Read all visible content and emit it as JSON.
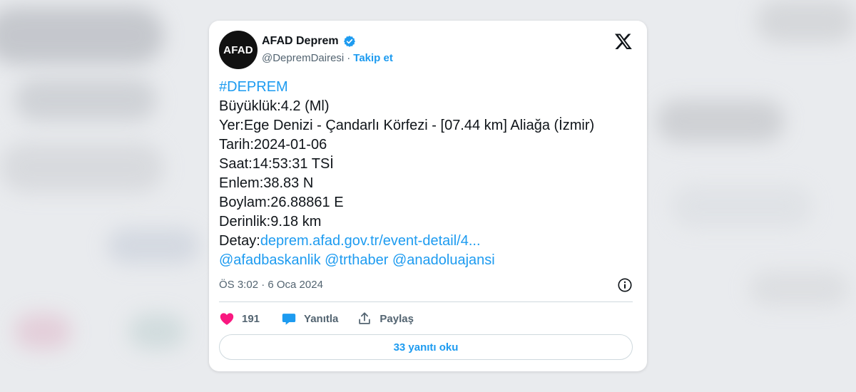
{
  "author": {
    "avatar_text": "AFAD",
    "display_name": "AFAD Deprem",
    "handle": "@DepremDairesi",
    "separator": "·",
    "follow_label": "Takip et"
  },
  "icons": {
    "verified": "verified-badge-icon",
    "platform": "x-logo-icon",
    "info": "info-icon",
    "like": "heart-icon",
    "reply": "reply-bubble-icon",
    "share": "share-icon"
  },
  "colors": {
    "link": "#1d9bf0",
    "like": "#f91880",
    "text": "#0f1419",
    "muted": "#536471"
  },
  "tweet": {
    "hashtag": "#DEPREM",
    "lines": {
      "magnitude": "Büyüklük:4.2 (Ml)",
      "location": "Yer:Ege Denizi - Çandarlı Körfezi - [07.44 km] Aliağa (İzmir)",
      "date": "Tarih:2024-01-06",
      "time": "Saat:14:53:31 TSİ",
      "latitude": "Enlem:38.83 N",
      "longitude": "Boylam:26.88861 E",
      "depth": "Derinlik:9.18 km"
    },
    "detail_label": "Detay:",
    "detail_link": "deprem.afad.gov.tr/event-detail/4...",
    "mentions": [
      "@afadbaskanlik",
      "@trthaber",
      "@anadoluajansi"
    ],
    "timestamp": "ÖS 3:02 · 6 Oca 2024"
  },
  "actions": {
    "like_count": "191",
    "reply_label": "Yanıtla",
    "share_label": "Paylaş"
  },
  "replies_button": "33 yanıtı oku"
}
